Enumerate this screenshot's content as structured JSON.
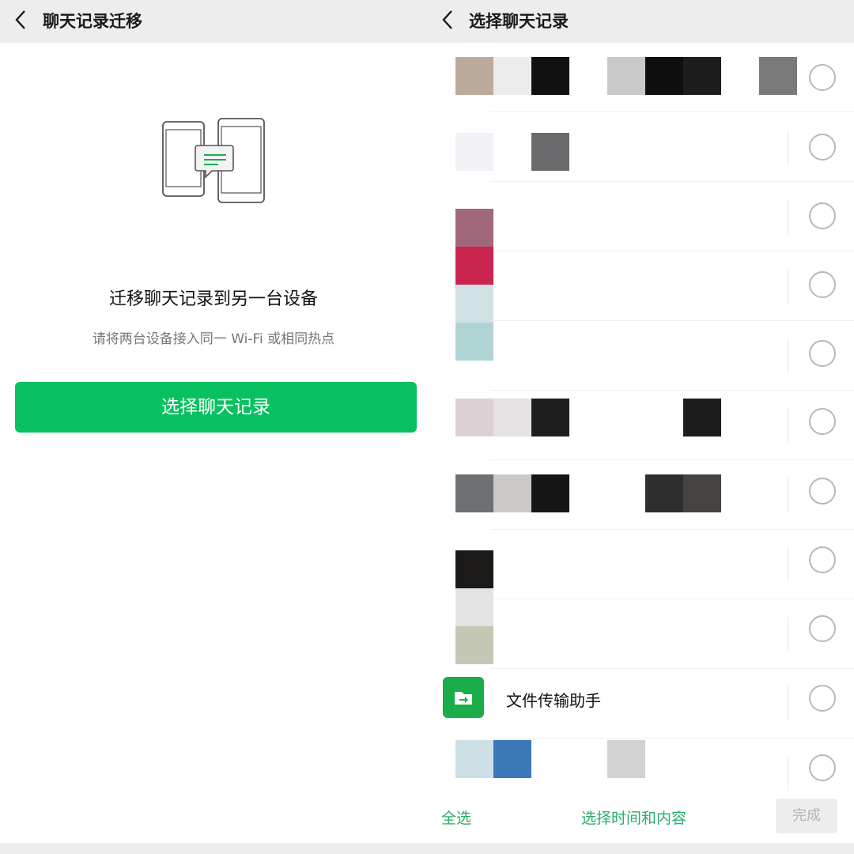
{
  "left": {
    "title": "聊天记录迁移",
    "back_icon": "chevron-left",
    "headline": "迁移聊天记录到另一台设备",
    "subline": "请将两台设备接入同一 Wi-Fi 或相同热点",
    "primary_button": "选择聊天记录",
    "accent": "#07c160"
  },
  "right": {
    "title": "选择聊天记录",
    "back_icon": "chevron-left",
    "file_transfer_name": "文件传输助手",
    "select_all": "全选",
    "select_time_content": "选择时间和内容",
    "done": "完成"
  }
}
